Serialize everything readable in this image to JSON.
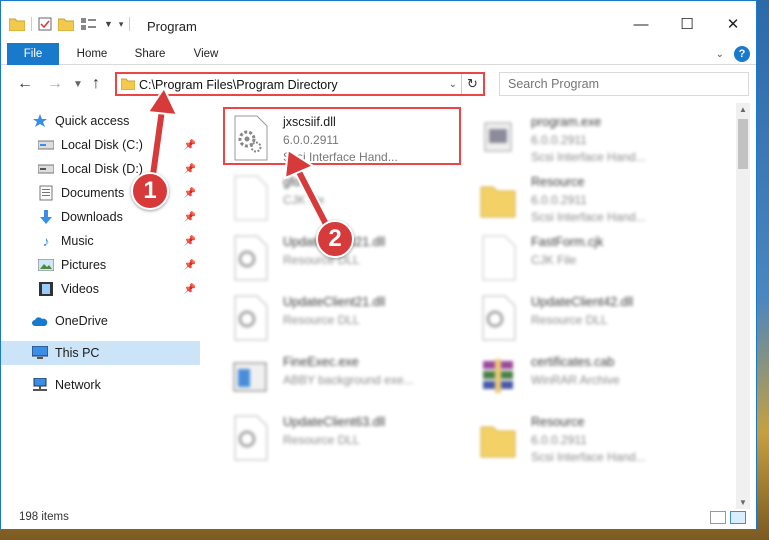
{
  "window": {
    "title": "Program"
  },
  "ribbon": {
    "tabs": [
      "File",
      "Home",
      "Share",
      "View"
    ]
  },
  "nav": {
    "address": "C:\\Program Files\\Program Directory",
    "search_placeholder": "Search Program"
  },
  "sidebar": {
    "items": [
      {
        "label": "Quick access",
        "icon": "star-icon"
      },
      {
        "label": "Local Disk (C:)",
        "icon": "drive-icon"
      },
      {
        "label": "Local Disk (D:)",
        "icon": "drive-icon"
      },
      {
        "label": "Documents",
        "icon": "documents-icon"
      },
      {
        "label": "Downloads",
        "icon": "download-icon"
      },
      {
        "label": "Music",
        "icon": "music-icon"
      },
      {
        "label": "Pictures",
        "icon": "pictures-icon"
      },
      {
        "label": "Videos",
        "icon": "videos-icon"
      },
      {
        "label": "OneDrive",
        "icon": "cloud-icon"
      },
      {
        "label": "This PC",
        "icon": "computer-icon"
      },
      {
        "label": "Network",
        "icon": "network-icon"
      }
    ]
  },
  "files": [
    {
      "name": "jxscsiif.dll",
      "line2": "6.0.0.2911",
      "line3": "Scsi Interface Hand...",
      "icon": "dll-gear-icon"
    },
    {
      "name": "program.exe",
      "line2": "6.0.0.2911",
      "line3": "Scsi Interface Hand...",
      "icon": "exe-icon"
    },
    {
      "name": "gfd",
      "line2": "CJK file",
      "line3": "",
      "icon": "blank-file-icon"
    },
    {
      "name": "Resource",
      "line2": "6.0.0.2911",
      "line3": "Scsi Interface Hand...",
      "icon": "folder-icon"
    },
    {
      "name": "UpdateClient21.dll",
      "line2": "Resource DLL",
      "line3": "",
      "icon": "dll-gear-icon"
    },
    {
      "name": "FastForm.cjk",
      "line2": "CJK File",
      "line3": "",
      "icon": "blank-file-icon"
    },
    {
      "name": "UpdateClient21.dll",
      "line2": "Resource DLL",
      "line3": "",
      "icon": "dll-gear-icon"
    },
    {
      "name": "UpdateClient42.dll",
      "line2": "Resource DLL",
      "line3": "",
      "icon": "dll-gear-icon"
    },
    {
      "name": "FineExec.exe",
      "line2": "ABBY background exe...",
      "line3": "",
      "icon": "app-window-icon"
    },
    {
      "name": "certificates.cab",
      "line2": "WinRAR Archive",
      "line3": "",
      "icon": "archive-icon"
    },
    {
      "name": "UpdateClient63.dll",
      "line2": "Resource DLL",
      "line3": "",
      "icon": "dll-gear-icon"
    },
    {
      "name": "Resource",
      "line2": "6.0.0.2911",
      "line3": "Scsi Interface Hand...",
      "icon": "folder-icon"
    }
  ],
  "status": {
    "count": "198 items"
  },
  "annotations": {
    "step1": "1",
    "step2": "2"
  },
  "colors": {
    "accent": "#1979ca",
    "highlight": "#e44444",
    "selected": "#cce4f7"
  }
}
